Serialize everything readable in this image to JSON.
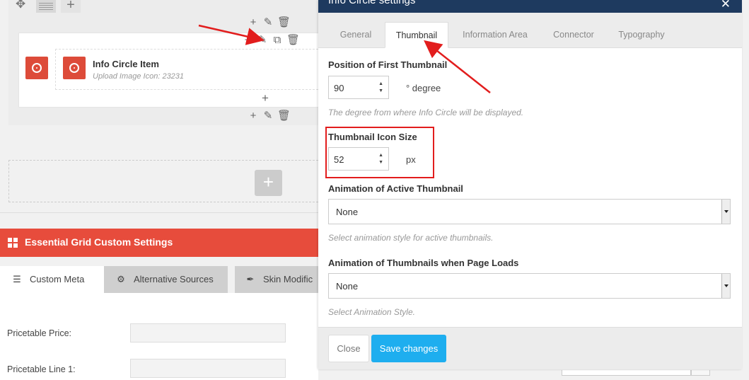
{
  "builder": {
    "item_title": "Info Circle Item",
    "item_subtitle": "Upload Image Icon: 23231",
    "icons": [
      "move-icon",
      "layout-icon",
      "plus-icon",
      "pencil-icon",
      "clone-icon",
      "trash-icon",
      "info-circle-icon"
    ]
  },
  "essential_grid": {
    "title": "Essential Grid Custom Settings",
    "tabs": [
      {
        "label": "Custom Meta",
        "icon": "list-icon"
      },
      {
        "label": "Alternative Sources",
        "icon": "sources-icon"
      },
      {
        "label": "Skin Modific",
        "icon": "wand-icon"
      }
    ],
    "fields": [
      {
        "label": "Pricetable Price:"
      },
      {
        "label": "Pricetable Line 1:"
      }
    ]
  },
  "modal": {
    "title": "Info Circle settings",
    "tabs": [
      "General",
      "Thumbnail",
      "Information Area",
      "Connector",
      "Typography"
    ],
    "active_tab": "Thumbnail",
    "position_first_thumbnail": {
      "label": "Position of First Thumbnail",
      "value": "90",
      "unit": "° degree",
      "help": "The degree from where Info Circle will be displayed."
    },
    "thumbnail_icon_size": {
      "label": "Thumbnail Icon Size",
      "value": "52",
      "unit": "px"
    },
    "animation_active": {
      "label": "Animation of Active Thumbnail",
      "value": "None",
      "help": "Select animation style for active thumbnails."
    },
    "animation_load": {
      "label": "Animation of Thumbnails when Page Loads",
      "value": "None",
      "help": "Select Animation Style."
    },
    "close_label": "Close",
    "save_label": "Save changes"
  },
  "colors": {
    "modal_header": "#1e3a5f",
    "accent_blue": "#1eaeef",
    "brand_red": "#e74c3c",
    "annotation_red": "#e21d1d"
  }
}
